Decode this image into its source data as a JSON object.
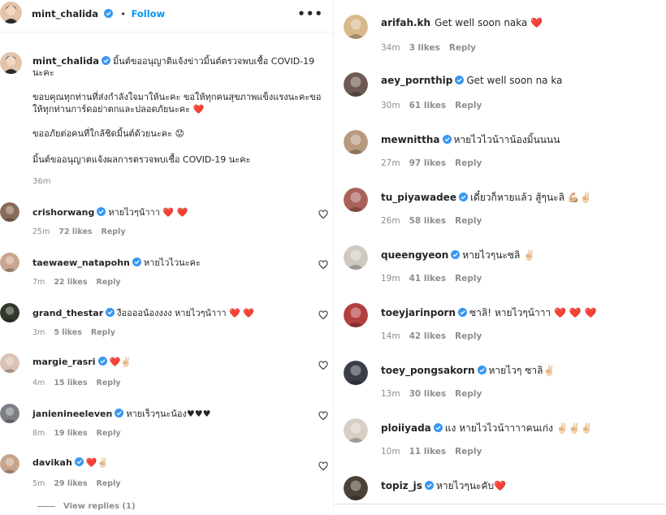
{
  "post": {
    "author": "mint_chalida",
    "follow_label": "Follow",
    "separator": "•",
    "menu": "•••",
    "caption_lines": [
      "มิ้นต์ขออนุญาติแจ้งข่าวมิ้นต์ตรวจพบเชื้อ COVID-19",
      "นะคะ",
      "ขอบคุณทุกท่านที่ส่งกำลังใจมาให้นะคะ ขอให้ทุกคนสุขภาพแข็งแรงนะคะขอ",
      "ให้ทุกท่านการ์ดอย่าตกและปลอดภัยนะคะ ❤️",
      "ขออภัยต่อคนที่ใกล้ชิดมิ้นต์ด้วยนะคะ 😟",
      "มิ้นต์ขออนุญาตแจ้งผลการตรวจพบเชื้อ COVID-19 นะคะ"
    ],
    "time": "36m"
  },
  "left_comments": [
    {
      "user": "crishorwang",
      "text": "หายไวๆน้าาา ❤️ ❤️",
      "time": "25m",
      "likes": "72 likes",
      "reply": "Reply",
      "avatar_color": "#8a6a5a"
    },
    {
      "user": "taewaew_natapohn",
      "text": "หายไวไวนะคะ",
      "time": "7m",
      "likes": "22 likes",
      "reply": "Reply",
      "avatar_color": "#c9a48e"
    },
    {
      "user": "grand_thestar",
      "text": "งืออออน้องงงง หายไวๆน้าาา ❤️ ❤️",
      "time": "3m",
      "likes": "5 likes",
      "reply": "Reply",
      "avatar_color": "#2f3a2a"
    },
    {
      "user": "margie_rasri",
      "text": "❤️✌🏻",
      "time": "4m",
      "likes": "15 likes",
      "reply": "Reply",
      "avatar_color": "#d9c2b4"
    },
    {
      "user": "janienineeleven",
      "text": "หายเร็วๆนะน้อง♥♥♥",
      "time": "8m",
      "likes": "19 likes",
      "reply": "Reply",
      "avatar_color": "#7d7f86"
    },
    {
      "user": "davikah",
      "text": "❤️✌🏻",
      "time": "5m",
      "likes": "29 likes",
      "reply": "Reply",
      "avatar_color": "#c7a58c"
    }
  ],
  "view_replies": "View replies (1)",
  "right_comments": [
    {
      "user": "arifah.kh",
      "verified": false,
      "text": "Get well soon naka ❤️",
      "time": "34m",
      "likes": "3 likes",
      "reply": "Reply",
      "avatar_color": "#d8b98c"
    },
    {
      "user": "aey_pornthip",
      "verified": true,
      "text": "Get well soon na ka",
      "time": "30m",
      "likes": "61 likes",
      "reply": "Reply",
      "avatar_color": "#6e5a52"
    },
    {
      "user": "mewnittha",
      "verified": true,
      "text": "หายไวไวน้าาน้องมิ้นนนน",
      "time": "27m",
      "likes": "97 likes",
      "reply": "Reply",
      "avatar_color": "#b89a7e"
    },
    {
      "user": "tu_piyawadee",
      "verified": true,
      "text": "เดี๋ยวก็หายแล้ว สู้ๆนะลิ 💪🏼✌🏻",
      "time": "26m",
      "likes": "58 likes",
      "reply": "Reply",
      "avatar_color": "#a8625a"
    },
    {
      "user": "queengyeon",
      "verified": true,
      "text": "หายไวๆนะซลิ ✌🏻",
      "time": "19m",
      "likes": "41 likes",
      "reply": "Reply",
      "avatar_color": "#cfc9c2"
    },
    {
      "user": "toeyjarinporn",
      "verified": true,
      "text": "ซาลิ! หายไวๆน้าาา ❤️ ❤️ ❤️",
      "time": "14m",
      "likes": "42 likes",
      "reply": "Reply",
      "avatar_color": "#b2403e"
    },
    {
      "user": "toey_pongsakorn",
      "verified": true,
      "text": "หายไวๆ ซาลิ✌🏻",
      "time": "13m",
      "likes": "30 likes",
      "reply": "Reply",
      "avatar_color": "#3a3e48"
    },
    {
      "user": "ploiiyada",
      "verified": true,
      "text": "แง หายไวไวน้าาาาคนเก่ง ✌🏻✌🏻✌🏻",
      "time": "10m",
      "likes": "11 likes",
      "reply": "Reply",
      "avatar_color": "#d7cfc4"
    },
    {
      "user": "topiz_js",
      "verified": true,
      "text": "หายไวๆนะคับ❤️",
      "time": "",
      "likes": "",
      "reply": "",
      "avatar_color": "#4b4236"
    }
  ]
}
